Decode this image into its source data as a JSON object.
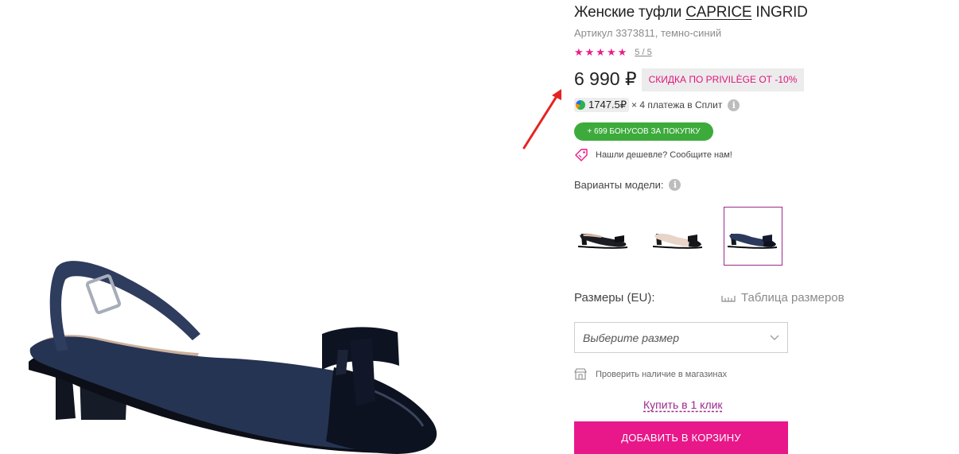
{
  "product": {
    "title_prefix": "Женские туфли ",
    "brand": "CAPRICE",
    "model": " INGRID",
    "sku_line": "Артикул 3373811, темно-синий",
    "rating_stars": "★★★★★",
    "rating_score": "5 / 5",
    "price": "6 990 ₽",
    "promo_badge": "СКИДКА ПО PRIVILÈGE ОТ -10%",
    "split": {
      "amount": "1747.5₽",
      "text": "× 4 платежа в Сплит",
      "info_glyph": "i"
    },
    "bonus_badge": "+ 699 БОНУСОВ ЗА ПОКУПКУ",
    "cheaper_text": "Нашли дешевле? Сообщите нам!"
  },
  "variants": {
    "label": "Варианты модели:",
    "info_glyph": "i",
    "items": [
      {
        "color_name": "black",
        "body": "#1b1d24",
        "lining": "#d7b8a1",
        "bow": "#0f0f14",
        "selected": false
      },
      {
        "color_name": "beige",
        "body": "#e8d5c8",
        "lining": "#e0c9b9",
        "bow": "#16161a",
        "selected": true
      },
      {
        "color_name": "navy",
        "body": "#2b3a5c",
        "lining": "#cfb39d",
        "bow": "#141a2c",
        "selected": true
      }
    ]
  },
  "sizes": {
    "label": "Размеры (EU):",
    "table_link": "Таблица размеров",
    "select_placeholder": "Выберите размер"
  },
  "availability_link": "Проверить наличие в магазинах",
  "one_click_link": "Купить в 1 клик",
  "add_to_cart_label": "ДОБАВИТЬ В КОРЗИНУ",
  "colors": {
    "accent_pink": "#e8178a",
    "accent_purple": "#9c2a8c",
    "green": "#3dab3c",
    "arrow_red": "#e52421"
  },
  "icons": [
    "arrow-annotation-icon",
    "star-icon",
    "split-logo-icon",
    "info-icon",
    "price-tag-icon",
    "ruler-icon",
    "chevron-down-icon",
    "store-icon"
  ]
}
